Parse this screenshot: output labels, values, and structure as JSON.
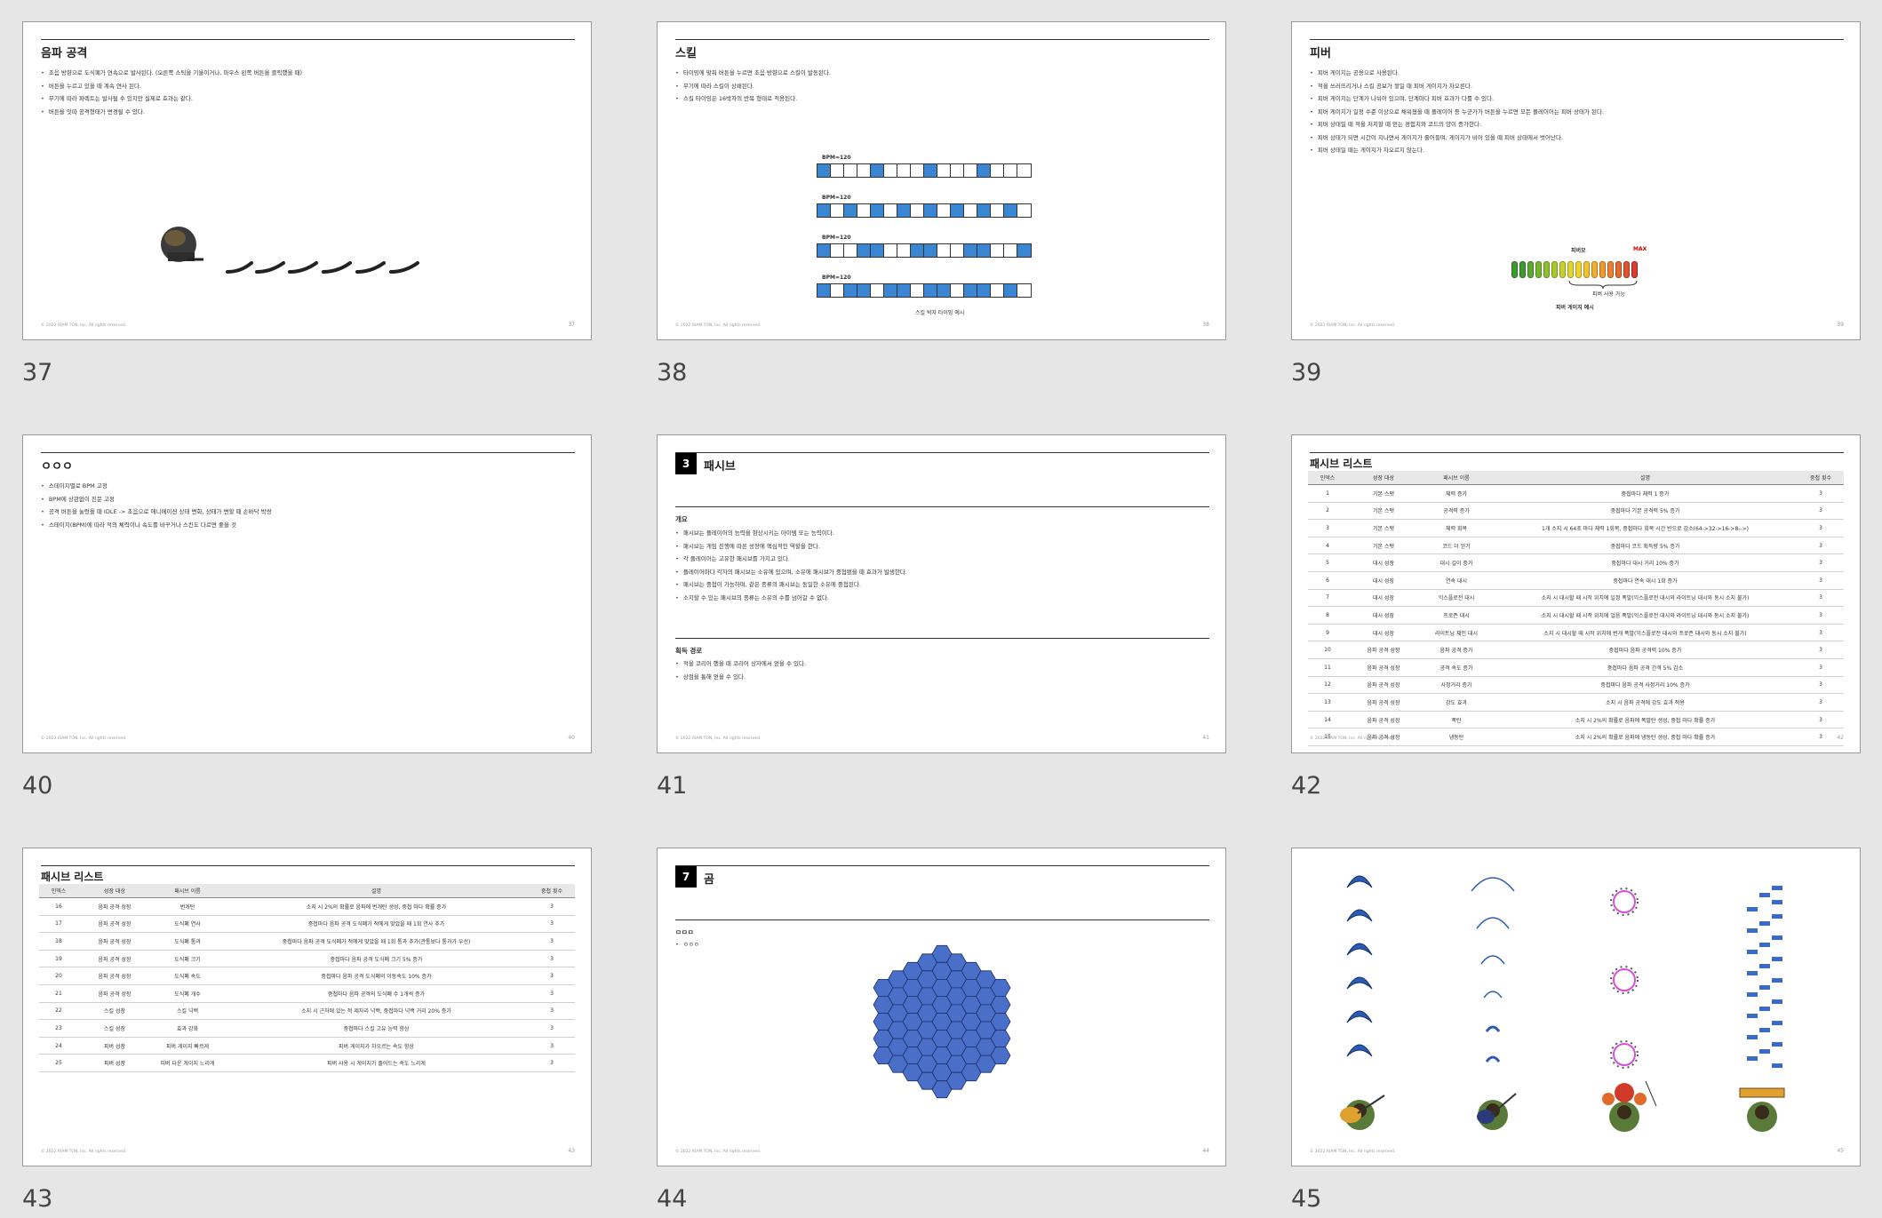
{
  "slides": [
    {
      "num": "37",
      "title": "음파 공격",
      "bullets": [
        "초음 방향으로 도식폐가 연속으로 발사된다. (오른쪽 스틱을 기울이거나, 마우스 왼쪽 버튼을 클릭했을 때)",
        "버튼을 누르고 있을 때 계속 연사 된다.",
        "무기에 따라 파렉트는 발사될 수 있지만 실제로 효과는 같다.",
        "버튼을 잇따 공격형태가 변경될 수 있다."
      ],
      "footer": "© 2022 RIAM TON, Inc. All rights reserved.",
      "page": "37"
    },
    {
      "num": "38",
      "title": "스킬",
      "bullets": [
        "타이밍에 맞춰 버튼을 누르면 초음 방향으로 스킬이 발동된다.",
        "무기에 따라 스킬이 상쇄된다.",
        "스킬 타이밍은 16박자의 반복 형태로 적용된다."
      ],
      "bpm": [
        "BPM=120",
        "BPM=120",
        "BPM=120",
        "BPM=120"
      ],
      "caption": "스킬 박자 타이밍 예시",
      "footer": "© 2022 RIAM TON, Inc. All rights reserved.",
      "page": "38"
    },
    {
      "num": "39",
      "title": "피버",
      "bullets": [
        "피버 게이지는 공용으로 사용된다.",
        "적을 쓰러뜨리거나 스킬 공보가 쌓일 때 피버 게이지가 차오른다.",
        "피버 게이지는 단계가 나뉘어 있으며, 단계마다 피버 효과가 다를 수 있다.",
        "피버 게이지가 일정 수준 이상으로 채워졌을 때 플레이어 등 누군가가 버튼을 누르면 모든 플레이어는 피버 상태가 된다.",
        "피버 상태일 때 적을 처치할 때 얻는 경험치와 코드의 양이 증가한다.",
        "피버 상태가 되면 시간이 지나면서 게이지가 줄어들며, 게이지가 비어 있을 때 피버 상태에서 벗어난다.",
        "피버 상태일 때는 게이지가 차오르지 않는다."
      ],
      "gauge_labels": {
        "mid": "피버모",
        "max": "MAX",
        "usable": "피버 사용 가능",
        "caption": "피버 게이지 예시"
      },
      "footer": "© 2022 RIAM TON, Inc. All rights reserved.",
      "page": "39"
    },
    {
      "num": "40",
      "title": "ㅇㅇㅇ",
      "bullets": [
        "스테이지별로 BPM 고정",
        "BPM에 상관없이 진문 고정",
        "공격 버튼을 눌렀을 때 IDLE -> 초음으로 애니메이션 상태 변화, 상태가 변할 때 손바닥 박쌍",
        "스테이지(BPM)에 따라 적의 체력이나 속도를 바꾸거나 스킨도 다르면 좋을 것"
      ],
      "footer": "© 2022 RIAM TON, Inc. All rights reserved.",
      "page": "40"
    },
    {
      "num": "41",
      "section_no": "3",
      "title": "패시브",
      "sub1": "개요",
      "bullets": [
        "패시브는 플레이어의 능력을 향상시키는 아이템 또는 능력이다.",
        "패시브는 게임 진행에 따른 성장에 핵심적인 역할을 한다.",
        "각 플레이어는 고유한 패시브를 가지고 있다.",
        "플레이어마다 각자의 패시브는 소유에 있으며, 소유에 패시브가 중첩됐을 때 효과가 발생한다.",
        "패시브는 중첩이 가능하며, 같은 종류의 패시브는 동일한 소유에 중첩된다.",
        "소지할 수 있는 패시브의 종류는 소유의 수를 넘어갈 수 없다."
      ],
      "sub2": "획득 경로",
      "bullets2": [
        "적을 코리어 했을 때 코리어 상자에서 얻을 수 있다.",
        "상점을 통해 얻을 수 있다."
      ],
      "footer": "© 2022 RIAM TON, Inc. All rights reserved.",
      "page": "41"
    },
    {
      "num": "42",
      "title": "패시브 리스트",
      "headers": [
        "인덱스",
        "성장 대상",
        "패시브 이름",
        "설명",
        "중첩 횟수"
      ],
      "rows": [
        [
          "1",
          "기본 스탯",
          "체력 증가",
          "중첩마다 체력 1 증가",
          "3"
        ],
        [
          "2",
          "기본 스탯",
          "공격력 증가",
          "중첩마다 기본 공격력 5% 증가",
          "3"
        ],
        [
          "3",
          "기본 스탯",
          "체력 회복",
          "1개 소지 시 64초 마다 체력 1회복, 중첩마다 회복 시간 반으로 감소(64->32->16->8-->)",
          "3"
        ],
        [
          "4",
          "기본 스탯",
          "코드 더 얻기",
          "중첩마다 코드 획득량 5% 증가",
          "3"
        ],
        [
          "5",
          "대시 성장",
          "대시 길이 증가",
          "중첩마다 대시 거리 10% 증가",
          "3"
        ],
        [
          "6",
          "대시 성장",
          "연속 대시",
          "중첩마다 연속 대시 1회 증가",
          "3"
        ],
        [
          "7",
          "대시 성장",
          "익스플로전 대시",
          "소지 시 대시할 때 시작 위치에 일정 폭발(익스플로전 대시와 라이트닝 대시와 동시 소지 불가)",
          "3"
        ],
        [
          "8",
          "대시 성장",
          "프로즌 대시",
          "소지 시 대시할 때 시작 위치에 얼음 폭발(익스플로전 대시와 라이트닝 대시와 동시 소지 불가)",
          "3"
        ],
        [
          "9",
          "대시 성장",
          "라이트닝 체인 대시",
          "소지 시 대시할 때 시작 위치에 번개 폭발(익스플로전 대시와 프로즌 대시와 동시 소지 불가)",
          "3"
        ],
        [
          "10",
          "음파 공격 성장",
          "음파 공격 증가",
          "중첩마다 음파 공격력 10% 증가",
          "3"
        ],
        [
          "11",
          "음파 공격 성장",
          "공격 속도 증가",
          "중첩마다 음파 공격 간격 5% 감소",
          "3"
        ],
        [
          "12",
          "음파 공격 성장",
          "사정거리 증가",
          "중첩마다 음파 공격 사정거리 10% 증가",
          "3"
        ],
        [
          "13",
          "음파 공격 성장",
          "강도 효과",
          "소지 시 음파 공격에 강도 효과 적용",
          "3"
        ],
        [
          "14",
          "음파 공격 성장",
          "폭탄",
          "소지 시 2%의 확률로 음파에 폭발탄 생성, 중첩 마다 확률 증가",
          "3"
        ],
        [
          "15",
          "음파 공격 성장",
          "냉동탄",
          "소지 시 2%의 확률로 음파에 냉동탄 생성, 중첩 마다 확률 증가",
          "3"
        ]
      ],
      "footer": "© 2022 RIAM TON, Inc. All rights reserved.",
      "page": "42"
    },
    {
      "num": "43",
      "title": "패시브 리스트",
      "headers": [
        "인덱스",
        "성장 대상",
        "패시브 이름",
        "설명",
        "중첩 횟수"
      ],
      "rows": [
        [
          "16",
          "음파 공격 성장",
          "번개탄",
          "소지 시 2%의 확률로 음파에 번개탄 생성, 중첩 마다 확률 증가",
          "3"
        ],
        [
          "17",
          "음파 공격 성장",
          "도식폐 연사",
          "중첩마다 음파 공격 도식폐가 적에게 맞았을 때 1회 연사 추가",
          "3"
        ],
        [
          "18",
          "음파 공격 성장",
          "도식폐 통과",
          "중첩마다 음파 공격 도식폐가 적에게 맞았을 때 1회 통과 추가(관통보다 통과가 우선)",
          "3"
        ],
        [
          "19",
          "음파 공격 성장",
          "도식폐 크기",
          "중첩마다 음파 공격 도식폐 크기 5% 증가",
          "3"
        ],
        [
          "20",
          "음파 공격 성장",
          "도식폐 속도",
          "중첩마다 음파 공격 도식폐의 이동속도 10% 증가",
          "3"
        ],
        [
          "21",
          "음파 공격 성장",
          "도식폐 개수",
          "중첩마다 음파 공격의 도식폐 수 1개씩 증가",
          "3"
        ],
        [
          "22",
          "스킬 성장",
          "스킬 넉백",
          "소지 시 근처에 있는 적 제자리 넉백, 중첩마다 넉백 거리 20% 증가",
          "3"
        ],
        [
          "23",
          "스킬 성장",
          "효과 강화",
          "중첩마다 스킬 고유 능력 향상",
          "3"
        ],
        [
          "24",
          "피버 성장",
          "피버 게이지 빠르게",
          "피버 게이지가 차오르는 속도 향상",
          "3"
        ],
        [
          "25",
          "피버 성장",
          "피버 다운 게이지 느리게",
          "피버 사용 시 게이지가 줄어드는 속도 느리게",
          "3"
        ]
      ],
      "footer": "© 2022 RIAM TON, Inc. All rights reserved.",
      "page": "43"
    },
    {
      "num": "44",
      "section_no": "7",
      "title": "곰",
      "sub1": "ㅁㅁㅁ",
      "bullets": [
        "ㅇㅇㅇ"
      ],
      "footer": "© 2022 RIAM TON, Inc. All rights reserved.",
      "page": "44"
    },
    {
      "num": "45",
      "footer": "© 2022 RIAM TON, Inc. All rights reserved.",
      "page": "45"
    }
  ],
  "colors": {
    "beat_on": "#3a86d3",
    "hex_fill": "#4a6fc9",
    "arc_blue": "#2a5bb5",
    "ring_pink": "#d54fd8",
    "bar_blue": "#3a6ac8"
  }
}
